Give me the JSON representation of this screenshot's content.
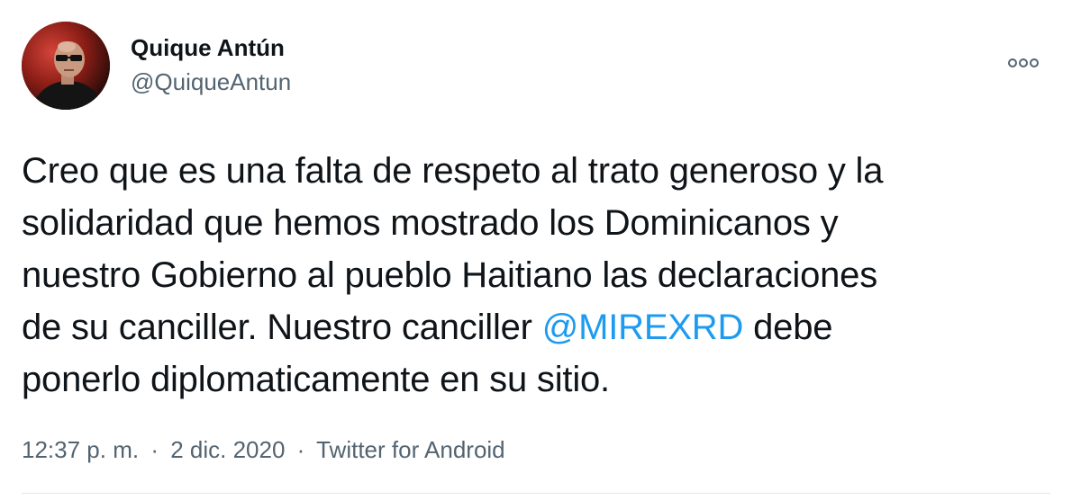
{
  "author": {
    "name": "Quique Antún",
    "handle": "@QuiqueAntun"
  },
  "tweet": {
    "lines": [
      "Creo que es una falta de respeto al trato generoso y la",
      "solidaridad que hemos mostrado los Dominicanos y",
      "nuestro Gobierno al pueblo Haitiano las declaraciones"
    ],
    "line4_before": "de su canciller. Nuestro canciller ",
    "mention": "@MIREXRD",
    "line4_after": " debe",
    "line5": "ponerlo diplomaticamente en su sitio."
  },
  "meta": {
    "time": "12:37 p. m.",
    "separator": "·",
    "date": "2 dic. 2020",
    "source": "Twitter for Android"
  },
  "icons": {
    "more": "more-options-icon",
    "avatar": "profile-photo"
  },
  "colors": {
    "text": "#0f1419",
    "secondary": "#536471",
    "link": "#1d9bf0"
  }
}
